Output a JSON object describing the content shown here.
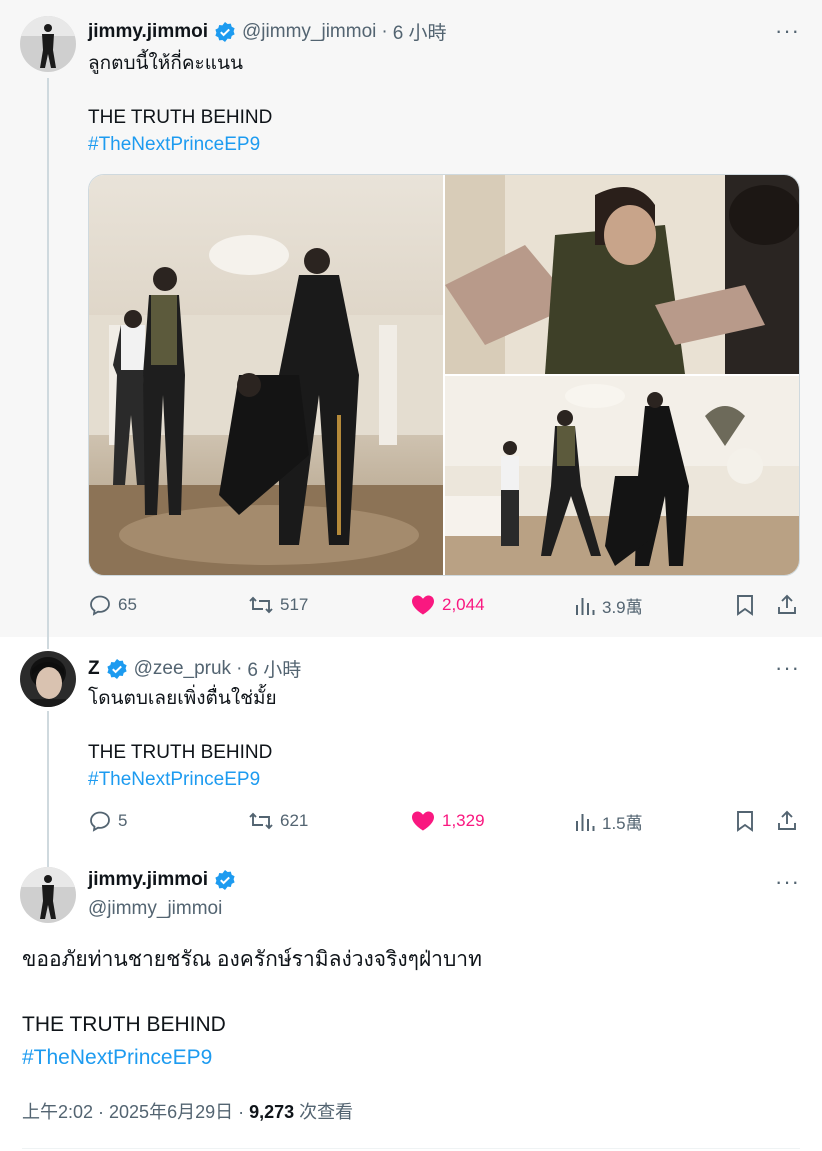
{
  "colors": {
    "accent": "#1d9bf0",
    "like": "#f91880",
    "secondary": "#536471"
  },
  "tweets": [
    {
      "name": "jimmy.jimmoi",
      "handle": "@jimmy_jimmoi",
      "time": "6 小時",
      "text": "ลูกตบนี้ให้กี่คะแนน",
      "body": "THE TRUTH BEHIND",
      "hashtag": "#TheNextPrinceEP9",
      "replies": "65",
      "retweets": "517",
      "likes": "2,044",
      "views": "3.9萬"
    },
    {
      "name": "Z",
      "handle": "@zee_pruk",
      "time": "6 小時",
      "text": "โดนตบเลยเพิ่งตื่นใช่มั้ย",
      "body": "THE TRUTH BEHIND",
      "hashtag": "#TheNextPrinceEP9",
      "replies": "5",
      "retweets": "621",
      "likes": "1,329",
      "views": "1.5萬"
    }
  ],
  "main": {
    "name": "jimmy.jimmoi",
    "handle": "@jimmy_jimmoi",
    "text": "ขออภัยท่านชายชรัณ องครักษ์รามิลง่วงจริงๆฝ่าบาท",
    "body": "THE TRUTH BEHIND",
    "hashtag": "#TheNextPrinceEP9",
    "time": "上午2:02 · 2025年6月29日 · ",
    "views": "9,273",
    "views_label": " 次查看"
  },
  "dot": "·",
  "more": "···"
}
